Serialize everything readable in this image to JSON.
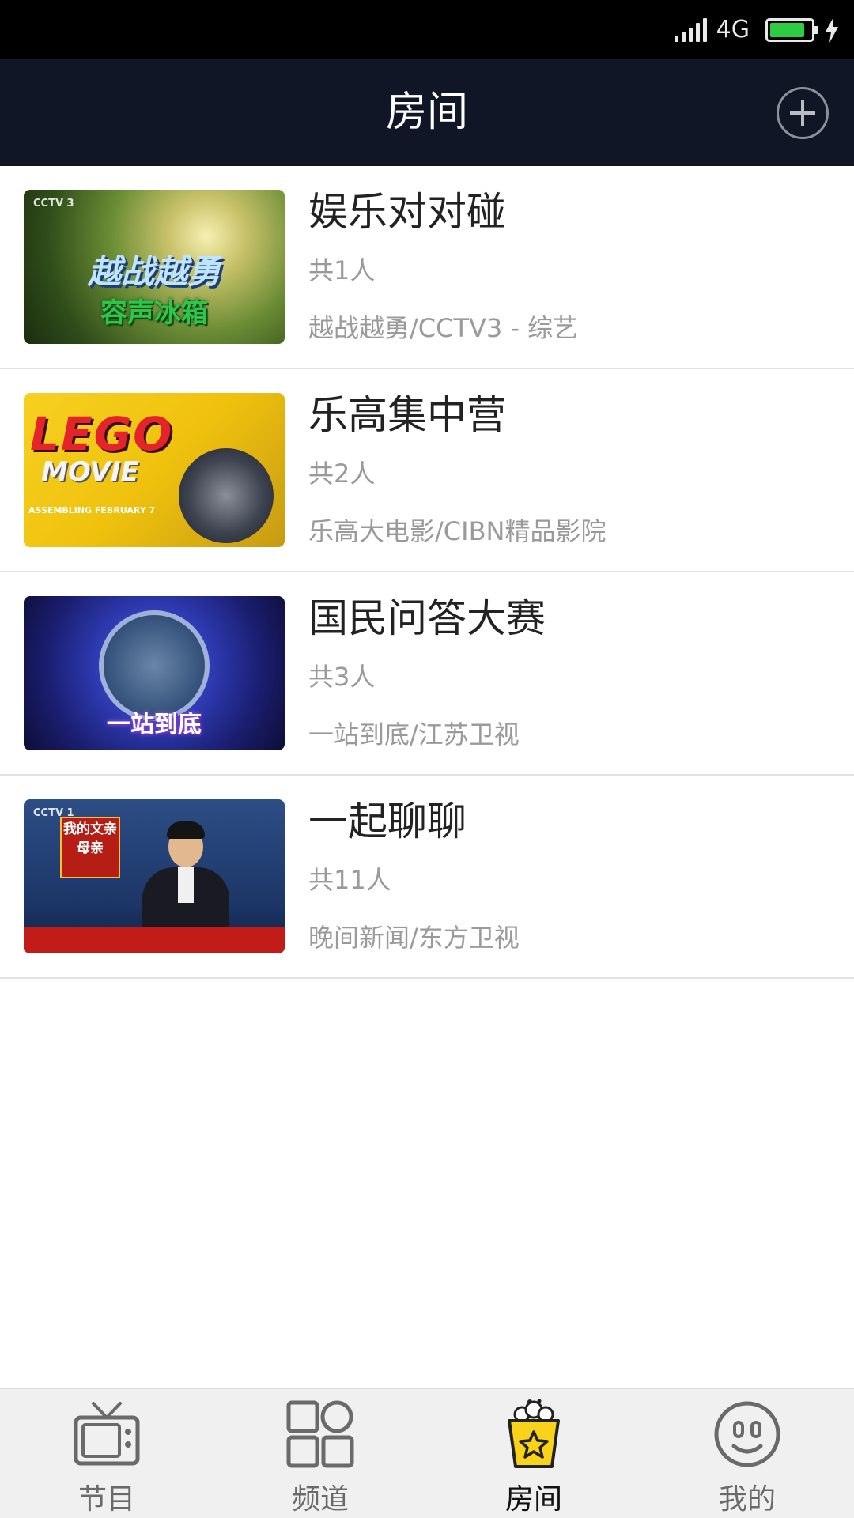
{
  "status_bar": {
    "network": "4G",
    "battery_level": 0.85,
    "battery_color": "#2ecc40"
  },
  "header": {
    "title": "房间",
    "add_icon": "plus-circle-icon"
  },
  "rooms": [
    {
      "name": "娱乐对对碰",
      "count": "共1人",
      "source": "越战越勇/CCTV3 - 综艺",
      "thumb_text": "容声冰箱",
      "thumb_tag": "CCTV 3"
    },
    {
      "name": "乐高集中营",
      "count": "共2人",
      "source": "乐高大电影/CIBN精品影院",
      "thumb_text": "LEGO",
      "thumb_tag": "ASSEMBLING FEBRUARY 7"
    },
    {
      "name": "国民问答大赛",
      "count": "共3人",
      "source": "一站到底/江苏卫视",
      "thumb_text": "一站到底",
      "thumb_tag": ""
    },
    {
      "name": "一起聊聊",
      "count": "共11人",
      "source": "晚间新闻/东方卫视",
      "thumb_text": "我的文亲母亲",
      "thumb_tag": "CCTV 1"
    }
  ],
  "tabs": [
    {
      "label": "节目",
      "icon": "tv-icon",
      "active": false
    },
    {
      "label": "频道",
      "icon": "grid-icon",
      "active": false
    },
    {
      "label": "房间",
      "icon": "popcorn-star-icon",
      "active": true
    },
    {
      "label": "我的",
      "icon": "smiley-face-icon",
      "active": false
    }
  ],
  "colors": {
    "header_bg": "#111626",
    "active_tab_accent": "#f9d21a",
    "secondary_text": "#9a9a9a"
  }
}
